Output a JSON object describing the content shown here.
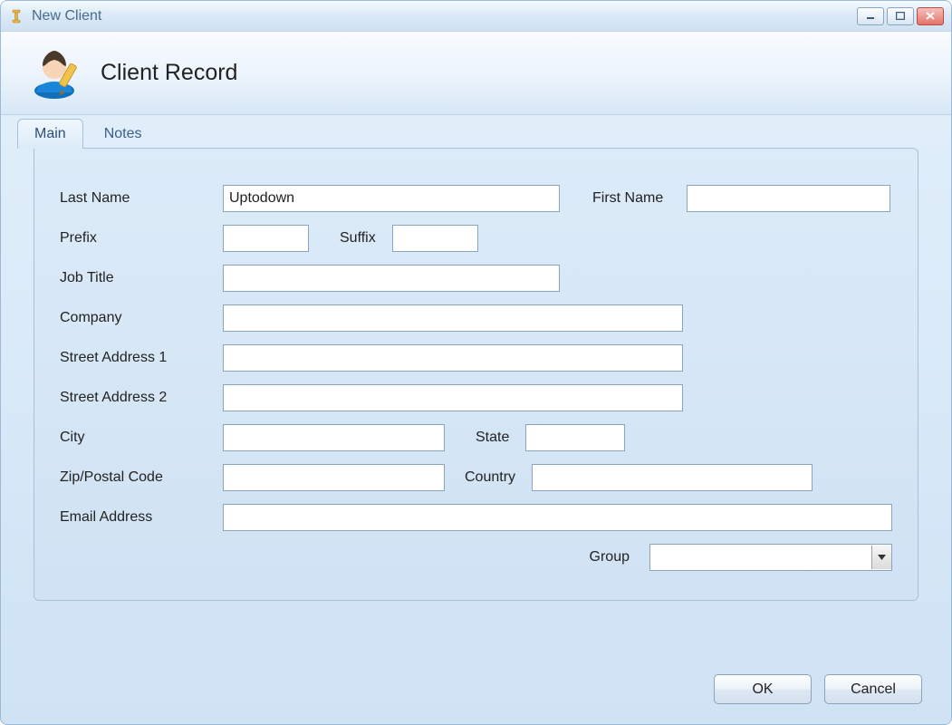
{
  "window": {
    "title": "New Client"
  },
  "header": {
    "title": "Client Record"
  },
  "tabs": {
    "main": "Main",
    "notes": "Notes"
  },
  "form": {
    "last_name_label": "Last Name",
    "last_name_value": "Uptodown",
    "first_name_label": "First Name",
    "first_name_value": "",
    "prefix_label": "Prefix",
    "prefix_value": "",
    "suffix_label": "Suffix",
    "suffix_value": "",
    "job_title_label": "Job Title",
    "job_title_value": "",
    "company_label": "Company",
    "company_value": "",
    "street1_label": "Street Address 1",
    "street1_value": "",
    "street2_label": "Street Address 2",
    "street2_value": "",
    "city_label": "City",
    "city_value": "",
    "state_label": "State",
    "state_value": "",
    "zip_label": "Zip/Postal Code",
    "zip_value": "",
    "country_label": "Country",
    "country_value": "",
    "email_label": "Email Address",
    "email_value": "",
    "group_label": "Group",
    "group_value": ""
  },
  "buttons": {
    "ok": "OK",
    "cancel": "Cancel"
  }
}
